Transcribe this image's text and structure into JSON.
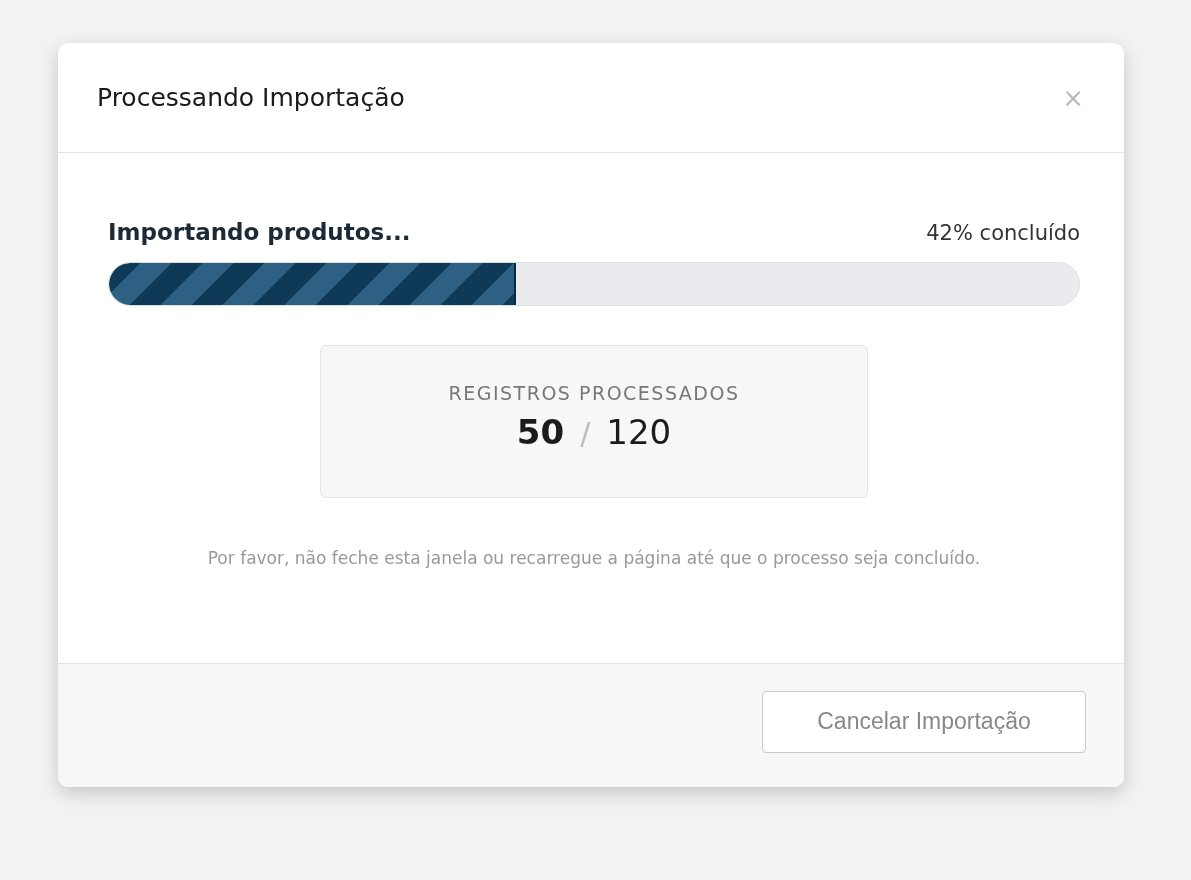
{
  "dialog": {
    "title": "Processando Importação",
    "close": "×"
  },
  "progress": {
    "label": "Importando produtos...",
    "reading": "42% concluído",
    "level": 0.42
  },
  "stats": {
    "label": "REGISTROS PROCESSADOS",
    "done": "50",
    "separator": "/",
    "total": "120"
  },
  "note": "Por favor, não feche esta janela ou recarregue a página até que o processo seja concluído.",
  "buttons": [
    {
      "label": "Cancelar Importação"
    }
  ]
}
